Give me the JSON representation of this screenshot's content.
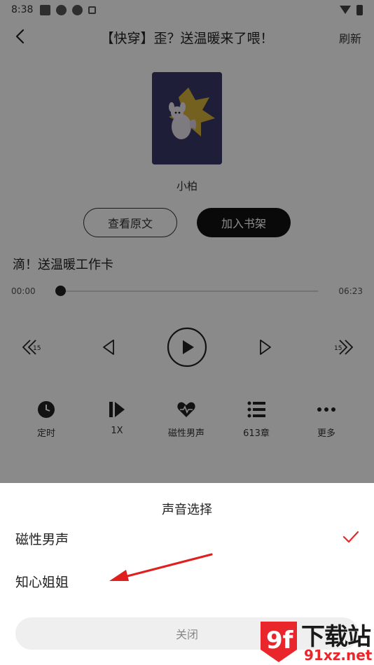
{
  "status_bar": {
    "time": "8:38"
  },
  "header": {
    "title": "【快穿】歪？送温暖来了喂！",
    "refresh_label": "刷新"
  },
  "book": {
    "author": "小柏",
    "view_original_label": "查看原文",
    "add_shelf_label": "加入书架"
  },
  "player": {
    "chapter_title": "滴！送温暖工作卡",
    "current_time": "00:00",
    "total_time": "06:23",
    "progress": 0.0
  },
  "tools": [
    {
      "label": "定时",
      "icon": "clock-icon"
    },
    {
      "label": "1X",
      "icon": "speed-icon"
    },
    {
      "label": "磁性男声",
      "icon": "heartbeat-icon"
    },
    {
      "label": "613章",
      "icon": "list-icon"
    },
    {
      "label": "更多",
      "icon": "more-icon"
    }
  ],
  "voice_sheet": {
    "title": "声音选择",
    "options": [
      {
        "label": "磁性男声",
        "selected": true
      },
      {
        "label": "知心姐姐",
        "selected": false
      }
    ],
    "close_label": "关闭"
  },
  "watermark": {
    "big": "下载站",
    "small": "91xz.net",
    "logo_text": "9f"
  },
  "colors": {
    "accent": "#e8262c",
    "overlay": "rgba(0,0,0,0.46)",
    "cover_bg": "#3a3868"
  }
}
